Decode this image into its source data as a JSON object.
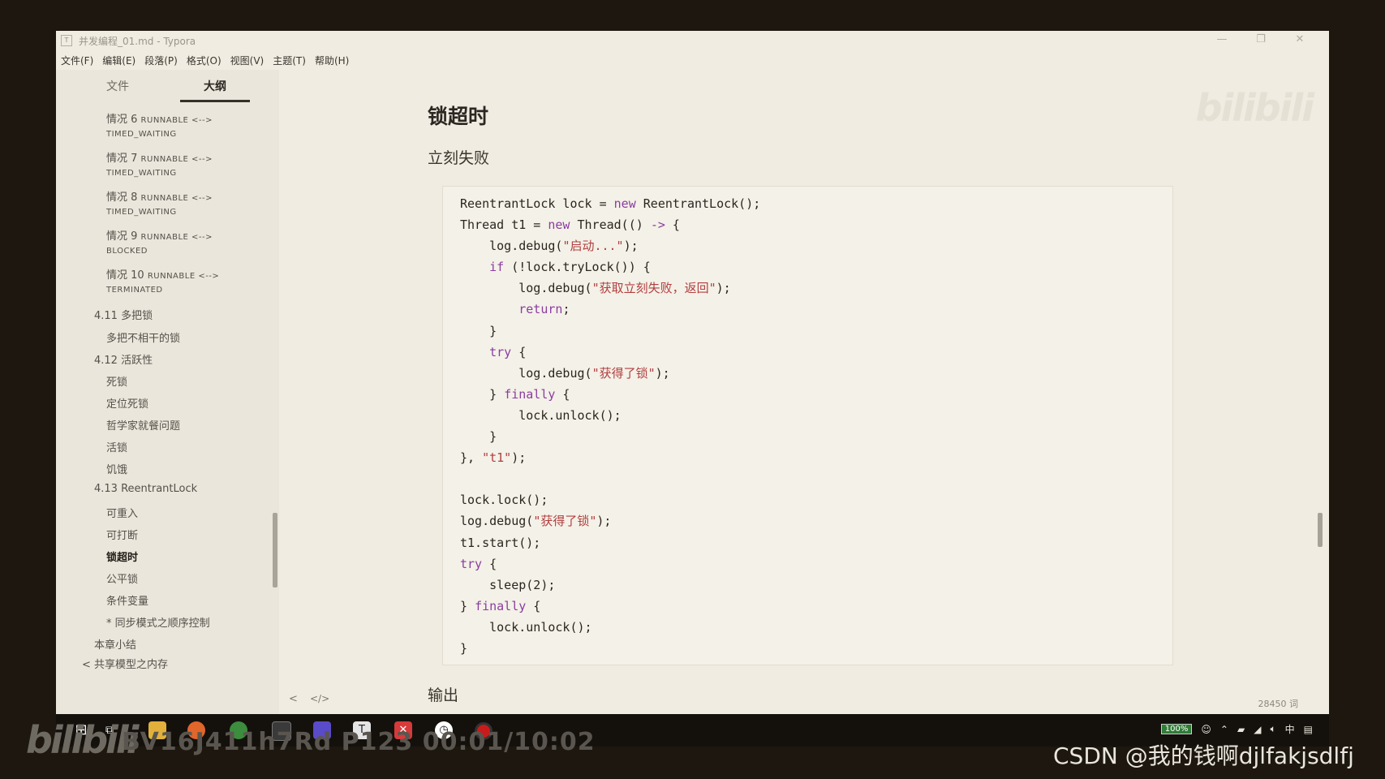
{
  "window": {
    "title": "并发编程_01.md - Typora",
    "app_icon": "T",
    "controls": [
      "—",
      "❐",
      "✕"
    ]
  },
  "menu": [
    "文件(F)",
    "编辑(E)",
    "段落(P)",
    "格式(O)",
    "视图(V)",
    "主题(T)",
    "帮助(H)"
  ],
  "sidebar": {
    "tabs": [
      "文件",
      "大纲"
    ],
    "active_tab": "大纲",
    "outline": [
      {
        "label": "情况 6",
        "tag": "RUNNABLE <-->",
        "line2": "TIMED_WAITING"
      },
      {
        "label": "情况 7",
        "tag": "RUNNABLE <-->",
        "line2": "TIMED_WAITING"
      },
      {
        "label": "情况 8",
        "tag": "RUNNABLE <-->",
        "line2": "TIMED_WAITING"
      },
      {
        "label": "情况 9",
        "tag": "RUNNABLE <-->",
        "line2": "BLOCKED"
      },
      {
        "label": "情况 10",
        "tag": "RUNNABLE <-->",
        "line2": "TERMINATED"
      },
      {
        "label": "4.11 多把锁"
      },
      {
        "label": "多把不相干的锁"
      },
      {
        "label": "4.12 活跃性"
      },
      {
        "label": "死锁"
      },
      {
        "label": "定位死锁"
      },
      {
        "label": "哲学家就餐问题"
      },
      {
        "label": "活锁"
      },
      {
        "label": "饥饿"
      },
      {
        "label": "4.13 ReentrantLock"
      },
      {
        "label": "可重入"
      },
      {
        "label": "可打断"
      },
      {
        "label": "锁超时"
      },
      {
        "label": "公平锁"
      },
      {
        "label": "条件变量"
      },
      {
        "label": "* 同步模式之顺序控制"
      },
      {
        "label": "本章小结"
      },
      {
        "label": "< 共享模型之内存"
      }
    ]
  },
  "editor": {
    "heading": "锁超时",
    "subheading": "立刻失败",
    "code_lines": [
      [
        {
          "t": "ReentrantLock lock = "
        },
        {
          "t": "new",
          "c": "k"
        },
        {
          "t": " ReentrantLock();"
        }
      ],
      [
        {
          "t": "Thread t1 = "
        },
        {
          "t": "new",
          "c": "k"
        },
        {
          "t": " Thread(() "
        },
        {
          "t": "->",
          "c": "k"
        },
        {
          "t": " {"
        }
      ],
      [
        {
          "t": "    log.debug("
        },
        {
          "t": "\"启动...\"",
          "c": "s"
        },
        {
          "t": ");"
        }
      ],
      [
        {
          "t": "    "
        },
        {
          "t": "if",
          "c": "k"
        },
        {
          "t": " (!lock.tryLock()) {"
        }
      ],
      [
        {
          "t": "        log.debug("
        },
        {
          "t": "\"获取立刻失败，返回\"",
          "c": "s"
        },
        {
          "t": ");"
        }
      ],
      [
        {
          "t": "        "
        },
        {
          "t": "return",
          "c": "k"
        },
        {
          "t": ";"
        }
      ],
      [
        {
          "t": "    }"
        }
      ],
      [
        {
          "t": "    "
        },
        {
          "t": "try",
          "c": "k"
        },
        {
          "t": " {"
        }
      ],
      [
        {
          "t": "        log.debug("
        },
        {
          "t": "\"获得了锁\"",
          "c": "s"
        },
        {
          "t": ");"
        }
      ],
      [
        {
          "t": "    } "
        },
        {
          "t": "finally",
          "c": "k"
        },
        {
          "t": " {"
        }
      ],
      [
        {
          "t": "        lock.unlock();"
        }
      ],
      [
        {
          "t": "    }"
        }
      ],
      [
        {
          "t": "}, "
        },
        {
          "t": "\"t1\"",
          "c": "s"
        },
        {
          "t": ");"
        }
      ],
      [
        {
          "t": ""
        }
      ],
      [
        {
          "t": "lock.lock();"
        }
      ],
      [
        {
          "t": "log.debug("
        },
        {
          "t": "\"获得了锁\"",
          "c": "s"
        },
        {
          "t": ");"
        }
      ],
      [
        {
          "t": "t1.start();"
        }
      ],
      [
        {
          "t": "try",
          "c": "k"
        },
        {
          "t": " {"
        }
      ],
      [
        {
          "t": "    sleep(2);"
        }
      ],
      [
        {
          "t": "} "
        },
        {
          "t": "finally",
          "c": "k"
        },
        {
          "t": " {"
        }
      ],
      [
        {
          "t": "    lock.unlock();"
        }
      ],
      [
        {
          "t": "}"
        }
      ]
    ],
    "next_heading": "输出",
    "word_count": "28450 词",
    "status_back": "<",
    "status_source": "</>"
  },
  "taskbar": {
    "apps": [
      "windows-start-icon",
      "task-view-icon",
      "file-explorer-icon",
      "firefox-icon",
      "chrome-icon",
      "terminal-icon",
      "intellij-icon",
      "typora-icon",
      "xmind-icon",
      "clock-app-icon",
      "recorder-icon"
    ],
    "battery": "100%",
    "ime": "中"
  },
  "overlays": {
    "bili_logo": "bilibili",
    "video_info": "BV16J411h7Rd P123 00:01/10:02",
    "csdn": "CSDN @我的钱啊djlfakjsdlfj"
  },
  "colors": {
    "keyword": "#8a3da0",
    "string": "#b13f3f",
    "editor_bg": "#f0ece1",
    "sidebar_bg": "#eae6db"
  }
}
